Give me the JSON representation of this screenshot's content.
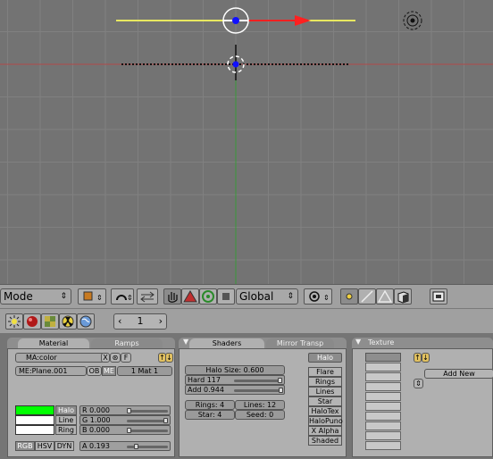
{
  "viewport": {
    "grid_color": "#8a8a8a",
    "bg_color": "#737373",
    "x_axis_color": "#c04040",
    "y_axis_color": "#40a040",
    "halo_line_color": "#f0f060",
    "arrow_color": "#ff2020"
  },
  "header": {
    "mode_label": "Mode",
    "orientation_label": "Global",
    "icons": [
      "object-type-icon",
      "view-rotate-icon",
      "view-pan-icon",
      "grab-hand-icon",
      "rotate-manipulator-icon",
      "scale-manipulator-icon",
      "stop-icon",
      "pivot-icon",
      "vertex-snap-icon",
      "edge-mode-icon",
      "face-mode-icon",
      "solid-cube-icon",
      "render-icon"
    ]
  },
  "buttons_header": {
    "context_icons": [
      "lamp-icon",
      "material-sphere-icon",
      "texture-icon",
      "radiation-icon",
      "world-icon"
    ],
    "frame_value": "1"
  },
  "material_panel": {
    "tabs": {
      "active": "Material",
      "inactive": "Ramps"
    },
    "ma_field": "MA:color",
    "ma_x": "X",
    "ma_f": "F",
    "me_field": "ME:Plane.001",
    "ob_label": "OB",
    "me_label": "ME",
    "mat_counter": "1 Mat 1",
    "color_rows": [
      {
        "label": "Halo",
        "color": "#00ff00",
        "active": true
      },
      {
        "label": "Line",
        "color": "#ffffff",
        "active": false
      },
      {
        "label": "Ring",
        "color": "#ffffff",
        "active": false
      }
    ],
    "r_label": "R 0.000",
    "r_value": 0.0,
    "g_label": "G 1.000",
    "g_value": 1.0,
    "b_label": "B 0.000",
    "b_value": 0.0,
    "a_label": "A 0.193",
    "a_value": 0.193,
    "color_models": [
      "RGB",
      "HSV",
      "DYN"
    ]
  },
  "shaders_panel": {
    "tabs": {
      "active": "Shaders",
      "inactive": "Mirror Transp"
    },
    "halo_size": "Halo Size: 0.600",
    "hard_label": "Hard 117",
    "hard_value": 0.9,
    "add_label": "Add  0.944",
    "add_value": 0.944,
    "rings": "Rings: 4",
    "lines": "Lines: 12",
    "star": "Star: 4",
    "seed": "Seed: 0",
    "toggles": [
      "Halo",
      "Flare",
      "Rings",
      "Lines",
      "Star",
      "HaloTex",
      "HaloPuno",
      "X Alpha",
      "Shaded"
    ]
  },
  "texture_panel": {
    "title": "Texture",
    "add_new": "Add New"
  }
}
